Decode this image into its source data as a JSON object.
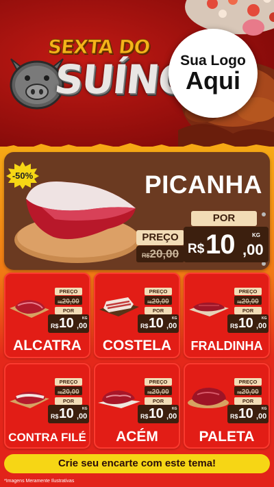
{
  "header": {
    "title_line1": "SEXTA DO",
    "title_line2": "SUÍNO",
    "logo_line1": "Sua Logo",
    "logo_line2": "Aqui"
  },
  "featured": {
    "name": "PICANHA",
    "discount": "-50%",
    "preco_label": "PREÇO",
    "currency_old": "R$",
    "old_price": "20,00",
    "por_label": "POR",
    "currency_new": "R$",
    "new_price_int": "10",
    "new_price_dec": ",00",
    "unit": "KG"
  },
  "products": [
    {
      "name": "ALCATRA",
      "preco_label": "PREÇO",
      "currency_old": "R$",
      "old_price": "20,00",
      "por_label": "POR",
      "currency_new": "R$",
      "new_price_int": "10",
      "new_price_dec": ",00",
      "unit": "KG"
    },
    {
      "name": "COSTELA",
      "preco_label": "PREÇO",
      "currency_old": "R$",
      "old_price": "20,00",
      "por_label": "POR",
      "currency_new": "R$",
      "new_price_int": "10",
      "new_price_dec": ",00",
      "unit": "KG"
    },
    {
      "name": "FRALDINHA",
      "preco_label": "PREÇO",
      "currency_old": "R$",
      "old_price": "20,00",
      "por_label": "POR",
      "currency_new": "R$",
      "new_price_int": "10",
      "new_price_dec": ",00",
      "unit": "KG"
    },
    {
      "name": "CONTRA FILÉ",
      "preco_label": "PREÇO",
      "currency_old": "R$",
      "old_price": "20,00",
      "por_label": "POR",
      "currency_new": "R$",
      "new_price_int": "10",
      "new_price_dec": ",00",
      "unit": "KG"
    },
    {
      "name": "ACÉM",
      "preco_label": "PREÇO",
      "currency_old": "R$",
      "old_price": "20,00",
      "por_label": "POR",
      "currency_new": "R$",
      "new_price_int": "10",
      "new_price_dec": ",00",
      "unit": "KG"
    },
    {
      "name": "PALETA",
      "preco_label": "PREÇO",
      "currency_old": "R$",
      "old_price": "20,00",
      "por_label": "POR",
      "currency_new": "R$",
      "new_price_int": "10",
      "new_price_dec": ",00",
      "unit": "KG"
    }
  ],
  "cta": "Crie seu encarte com este tema!",
  "disclaimer": "*Imagens Meramente Ilustrativas",
  "colors": {
    "background_red": "#e2231a",
    "header_dark_red": "#8e0d0b",
    "price_dark_brown": "#3c1f0e",
    "price_label_cream": "#f2dcb6",
    "featured_brown": "#6b3a21",
    "title_gold": "#f5b41a",
    "cta_yellow": "#f6d615"
  },
  "icons": [
    "pig-head-icon",
    "meat-picanha-image",
    "meat-cut-image",
    "discount-burst-icon"
  ]
}
